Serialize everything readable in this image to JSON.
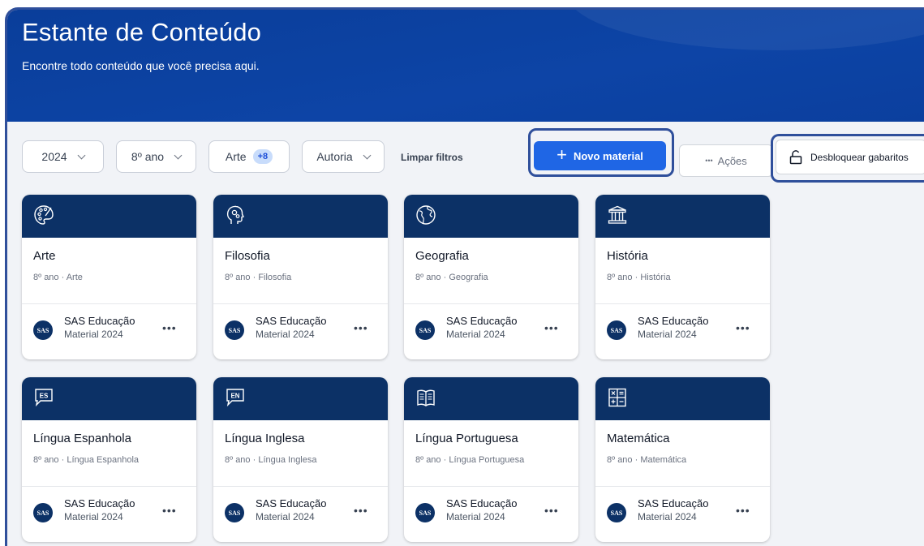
{
  "header": {
    "title": "Estante de Conteúdo",
    "subtitle": "Encontre todo conteúdo que você precisa aqui."
  },
  "filters": {
    "year": "2024",
    "grade": "8º ano",
    "subject": "Arte",
    "subject_count": "+8",
    "authorship": "Autoria",
    "clear": "Limpar filtros"
  },
  "actions": {
    "new_material": "Novo material",
    "more_actions": "Ações",
    "more_actions_dots": "•••",
    "unlock_answers": "Desbloquear gabaritos"
  },
  "cards": [
    {
      "title": "Arte",
      "subtitle": "8º ano · Arte",
      "publisher": "SAS Educação",
      "material": "Material 2024",
      "logo": "SAS",
      "more": "•••",
      "icon": "palette-icon"
    },
    {
      "title": "Filosofia",
      "subtitle": "8º ano · Filosofia",
      "publisher": "SAS Educação",
      "material": "Material 2024",
      "logo": "SAS",
      "more": "•••",
      "icon": "head-gears-icon"
    },
    {
      "title": "Geografia",
      "subtitle": "8º ano · Geografia",
      "publisher": "SAS Educação",
      "material": "Material 2024",
      "logo": "SAS",
      "more": "•••",
      "icon": "globe-icon"
    },
    {
      "title": "História",
      "subtitle": "8º ano · História",
      "publisher": "SAS Educação",
      "material": "Material 2024",
      "logo": "SAS",
      "more": "•••",
      "icon": "column-icon"
    },
    {
      "title": "Língua Espanhola",
      "subtitle": "8º ano · Língua Espanhola",
      "publisher": "SAS Educação",
      "material": "Material 2024",
      "logo": "SAS",
      "more": "•••",
      "icon": "speech-es-icon",
      "icon_text": "ES"
    },
    {
      "title": "Língua Inglesa",
      "subtitle": "8º ano · Língua Inglesa",
      "publisher": "SAS Educação",
      "material": "Material 2024",
      "logo": "SAS",
      "more": "•••",
      "icon": "speech-en-icon",
      "icon_text": "EN"
    },
    {
      "title": "Língua Portuguesa",
      "subtitle": "8º ano · Língua Portuguesa",
      "publisher": "SAS Educação",
      "material": "Material 2024",
      "logo": "SAS",
      "more": "•••",
      "icon": "open-book-icon"
    },
    {
      "title": "Matemática",
      "subtitle": "8º ano · Matemática",
      "publisher": "SAS Educação",
      "material": "Material 2024",
      "logo": "SAS",
      "more": "•••",
      "icon": "math-operators-icon"
    }
  ],
  "colors": {
    "header_blue": "#0d44a6",
    "card_header": "#0c3166",
    "primary_button": "#1f66e5",
    "highlight": "#2f4f9b"
  }
}
